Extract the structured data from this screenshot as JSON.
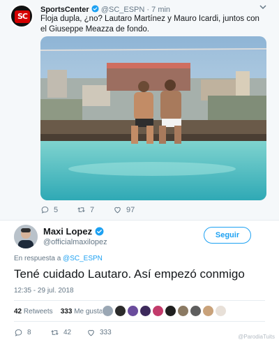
{
  "quoted_tweet": {
    "display_name": "SportsCenter",
    "verified": true,
    "handle": "@SC_ESPN",
    "separator": "·",
    "time": "7 min",
    "text": "Floja dupla, ¿no? Lautaro Martínez y Mauro Icardi, juntos con el Giuseppe Meazza de fondo.",
    "avatar_text": "SC",
    "actions": {
      "replies": "5",
      "retweets": "7",
      "likes": "97"
    }
  },
  "tweet": {
    "display_name": "Maxi Lopez",
    "verified": true,
    "handle": "@officialmaxilopez",
    "follow_label": "Seguir",
    "reply_prefix": "En respuesta a",
    "reply_to": "@SC_ESPN",
    "text": "Tené cuidado Lautaro. Así empezó conmigo",
    "timestamp": "12:35 - 29 jul. 2018",
    "retweets_count": "42",
    "retweets_label": "Retweets",
    "likes_count": "333",
    "likes_label": "Me gusta",
    "liker_colors": [
      "#9aa7b4",
      "#2b2b2b",
      "#6a4c9c",
      "#3d2a5c",
      "#c23b6b",
      "#1f1f1f",
      "#8b7a63",
      "#5e5e5e",
      "#c9a27a",
      "#e8e0d8"
    ],
    "actions": {
      "replies": "8",
      "retweets": "42",
      "likes": "333"
    }
  },
  "watermark": "@ParodiaTuits",
  "colors": {
    "accent": "#1da1f2",
    "secondary_text": "#657786",
    "background_quote": "#f5f8fa"
  }
}
